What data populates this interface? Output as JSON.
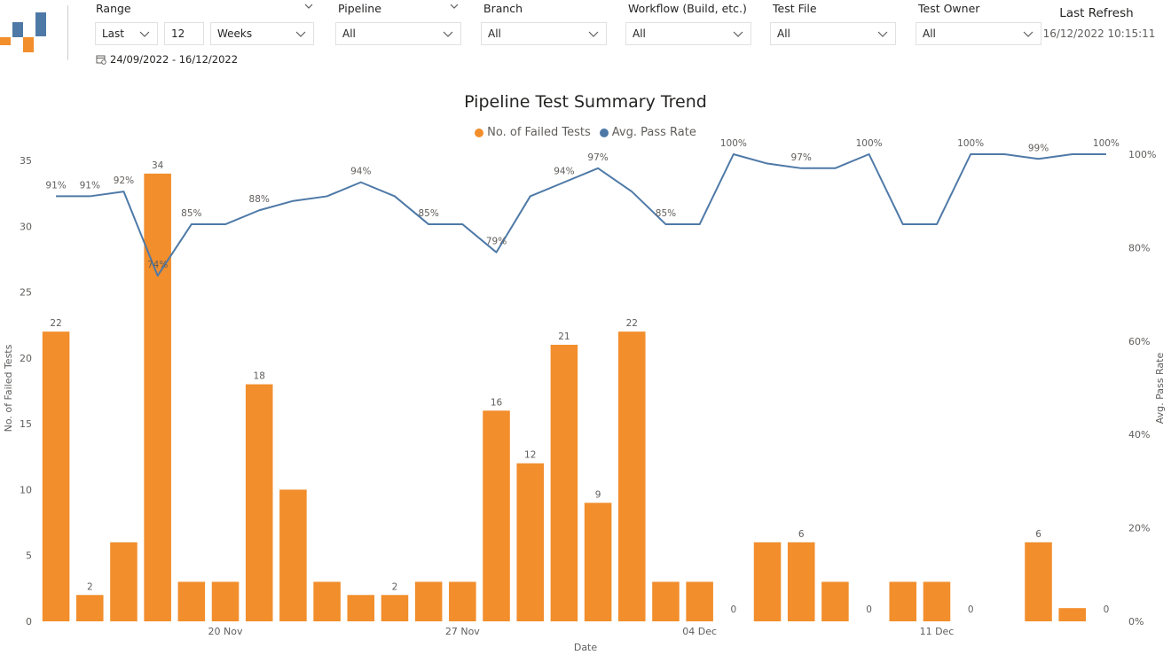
{
  "header": {
    "range": {
      "title": "Range",
      "mode": "Last",
      "count": "12",
      "unit": "Weeks",
      "date_range": "24/09/2022 - 16/12/2022"
    },
    "filters": [
      {
        "title": "Pipeline",
        "value": "All"
      },
      {
        "title": "Branch",
        "value": "All"
      },
      {
        "title": "Workflow (Build, etc.)",
        "value": "All"
      },
      {
        "title": "Test File",
        "value": "All"
      },
      {
        "title": "Test Owner",
        "value": "All"
      }
    ],
    "last_refresh": {
      "label": "Last Refresh",
      "value": "16/12/2022 10:15:11"
    }
  },
  "colors": {
    "bar": "#f28e2c",
    "line": "#4e79a7",
    "logo_orange": "#f28e2c",
    "logo_blue": "#4e79a7"
  },
  "chart_data": {
    "type": "bar+line",
    "title": "Pipeline Test Summary Trend",
    "xlabel": "Date",
    "ylabel": "No. of Failed Tests",
    "ylabel_right": "Avg. Pass Rate",
    "ylim": [
      0,
      35
    ],
    "ylim_right": [
      0,
      1
    ],
    "y_ticks": [
      "0",
      "5",
      "10",
      "15",
      "20",
      "25",
      "30",
      "35"
    ],
    "y_right_ticks": [
      "0%",
      "20%",
      "40%",
      "60%",
      "80%",
      "100%"
    ],
    "x_ticks": [
      {
        "label": "20 Nov",
        "index": 5
      },
      {
        "label": "27 Nov",
        "index": 12
      },
      {
        "label": "04 Dec",
        "index": 19
      },
      {
        "label": "11 Dec",
        "index": 26
      }
    ],
    "series": [
      {
        "name": "No. of Failed Tests",
        "type": "bar",
        "values": [
          22,
          2,
          6,
          34,
          3,
          3,
          18,
          10,
          3,
          2,
          2,
          3,
          3,
          16,
          12,
          21,
          9,
          22,
          3,
          3,
          0,
          6,
          6,
          3,
          0,
          3,
          3,
          0,
          null,
          6,
          1,
          0
        ],
        "labels": [
          "22",
          "2",
          "",
          "34",
          "",
          "",
          "18",
          "",
          "",
          "",
          "2",
          "",
          "",
          "16",
          "12",
          "21",
          "9",
          "22",
          "",
          "",
          "0",
          "",
          "6",
          "",
          "0",
          "",
          "",
          "0",
          "",
          "6",
          "",
          "0"
        ]
      },
      {
        "name": "Avg. Pass Rate",
        "type": "line",
        "values": [
          0.91,
          0.91,
          0.92,
          0.74,
          0.85,
          0.85,
          0.88,
          0.9,
          0.91,
          0.94,
          0.91,
          0.85,
          0.85,
          0.79,
          0.91,
          0.94,
          0.97,
          0.92,
          0.85,
          0.85,
          1.0,
          0.98,
          0.97,
          0.97,
          1.0,
          0.85,
          0.85,
          1.0,
          1.0,
          0.99,
          1.0,
          1.0
        ],
        "labels": [
          "91%",
          "91%",
          "92%",
          "74%",
          "85%",
          "",
          "88%",
          "",
          "",
          "94%",
          "",
          "85%",
          "",
          "79%",
          "",
          "94%",
          "97%",
          "",
          "85%",
          "",
          "100%",
          "",
          "97%",
          "",
          "100%",
          "",
          "",
          "100%",
          "",
          "99%",
          "",
          "100%"
        ]
      }
    ]
  }
}
